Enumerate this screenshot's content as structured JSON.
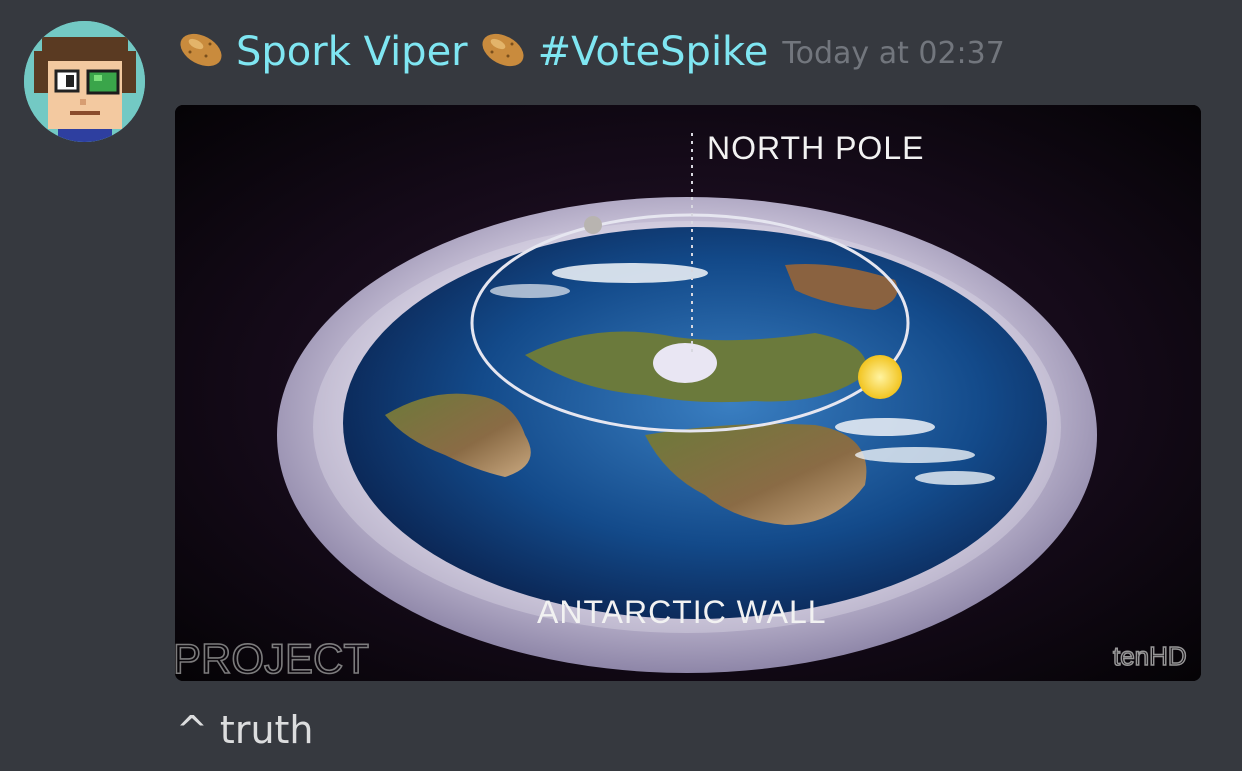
{
  "message": {
    "author": {
      "name": "Spork Viper",
      "tag": "#VoteSpike",
      "name_color": "#7fe6f2",
      "decoration_icon": "potato-icon"
    },
    "timestamp": "Today at 02:37",
    "content": "^ truth",
    "attachment": {
      "type": "image",
      "labels": {
        "top": "NORTH POLE",
        "bottom": "ANTARCTIC WALL",
        "watermark_left": "PROJECT",
        "watermark_right": "tenHD"
      }
    }
  }
}
